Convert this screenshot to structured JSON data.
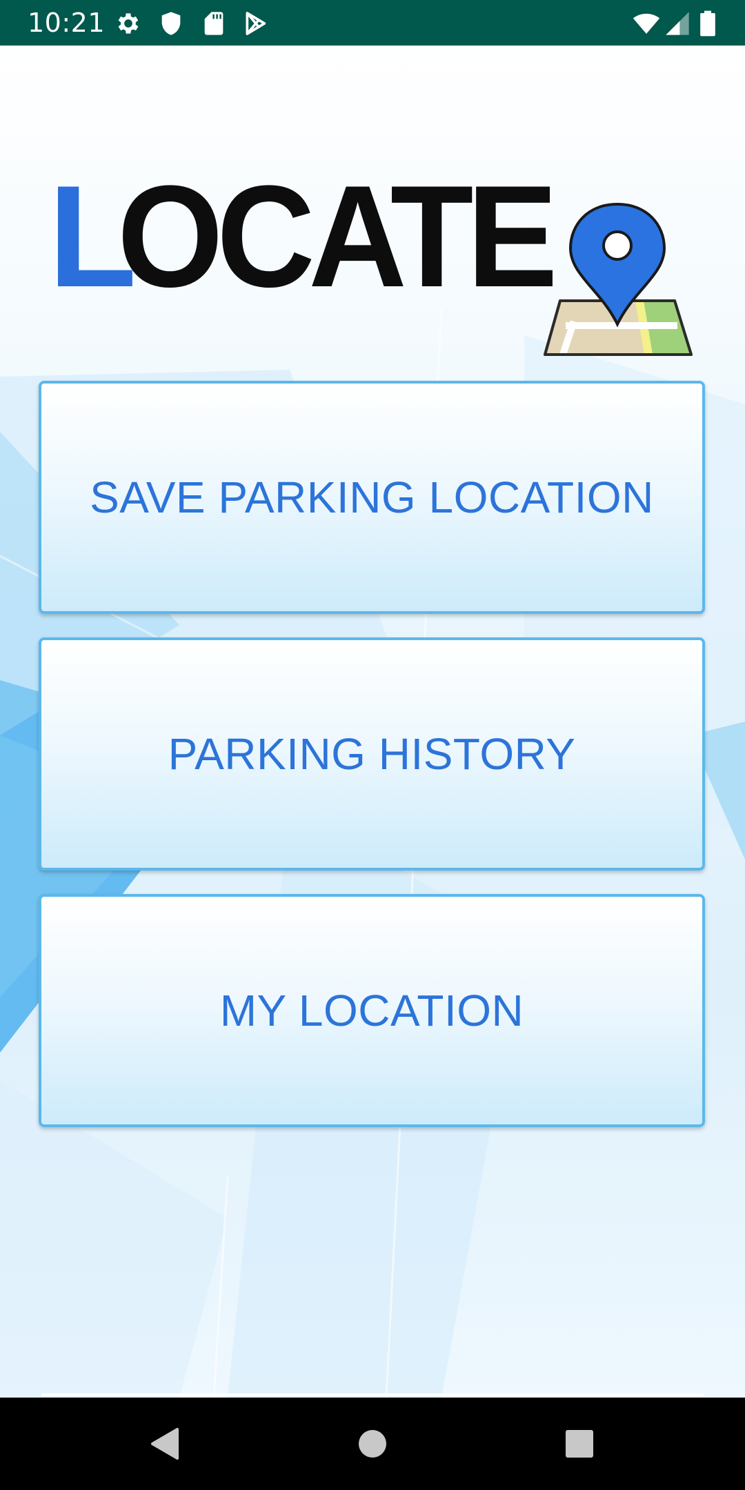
{
  "status_bar": {
    "time": "10:21",
    "left_icons": [
      "settings-icon",
      "shield-icon",
      "sd-card-icon",
      "play-store-icon"
    ],
    "right_icons": [
      "wifi-icon",
      "cell-signal-icon",
      "battery-icon"
    ],
    "background_color": "#01584c"
  },
  "logo": {
    "first_letter": "L",
    "rest": "OCATE",
    "first_letter_color": "#2a6fdb",
    "text_color": "#0d0d0d",
    "icon": "map-pin-icon"
  },
  "buttons": {
    "save_parking": "SAVE PARKING LOCATION",
    "parking_history": "PARKING HISTORY",
    "my_location": "MY LOCATION",
    "text_color": "#2c74d9",
    "border_color": "#5bb8ea"
  },
  "nav_bar": {
    "items": [
      "back-icon",
      "home-icon",
      "recents-icon"
    ]
  }
}
